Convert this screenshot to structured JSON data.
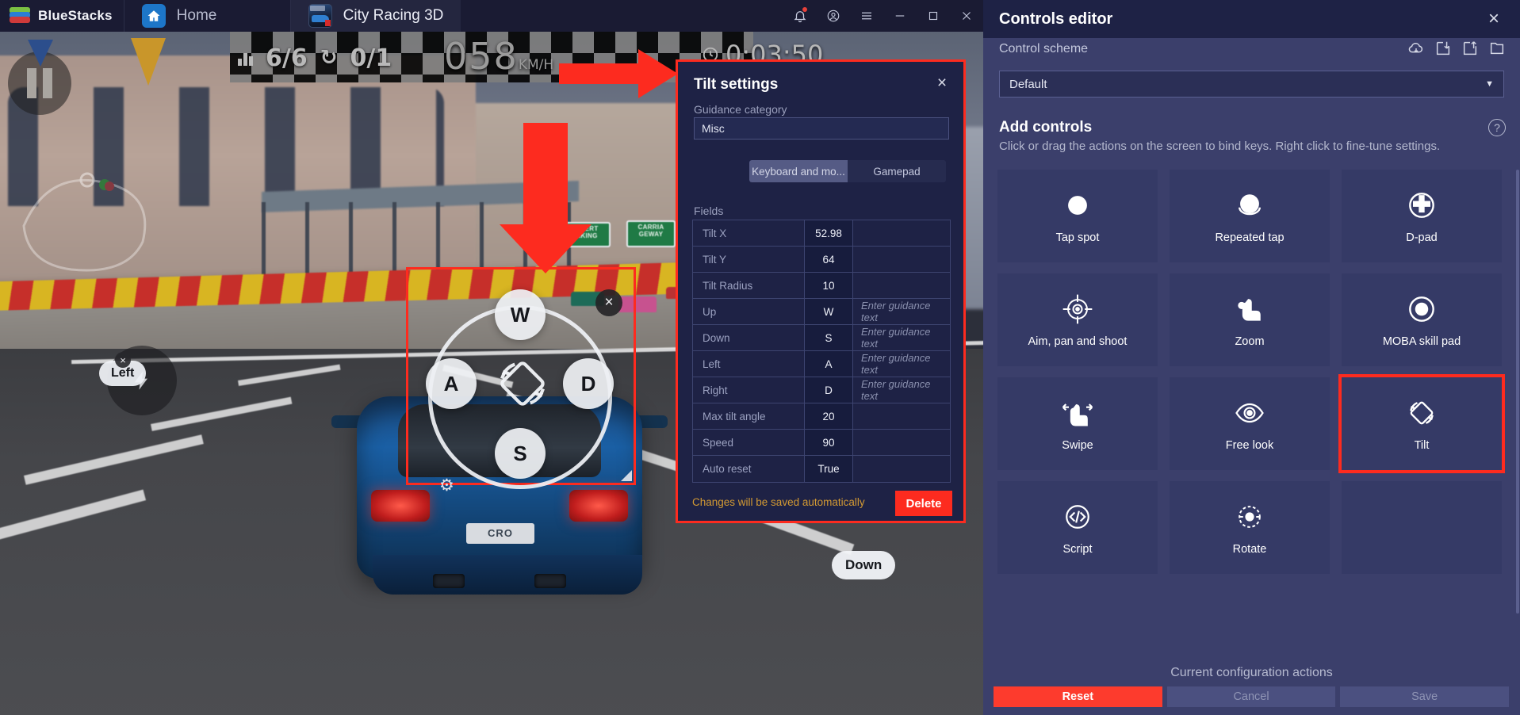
{
  "titlebar": {
    "brand": "BlueStacks",
    "tabs": [
      {
        "label": "Home",
        "icon": "home-icon"
      },
      {
        "label": "City Racing 3D",
        "icon": "game-thumbnail"
      }
    ],
    "window_buttons": [
      "notifications-bell",
      "account-circle",
      "hamburger-menu",
      "minimize",
      "maximize",
      "close"
    ]
  },
  "game_hud": {
    "position": "6/6",
    "laps": "0/1",
    "speed": "058",
    "speed_unit": "KM/H",
    "time": "0:03:50",
    "pause": "pause-icon"
  },
  "game_overlay": {
    "up_key": "W",
    "left_key": "A",
    "right_key": "D",
    "down_key": "S",
    "left_chip": "Left",
    "down_chip": "Down",
    "close": "×",
    "gear": "⚙",
    "car_plate": "CRO"
  },
  "tilt_dialog": {
    "title": "Tilt settings",
    "close": "×",
    "guidance_category_label": "Guidance category",
    "guidance_category_value": "Misc",
    "guidance_category_placeholder": "Guidance category",
    "segments": [
      {
        "label": "Keyboard and mo...",
        "active": true
      },
      {
        "label": "Gamepad",
        "active": false
      }
    ],
    "fields_label": "Fields",
    "guidance_placeholder": "Enter guidance text",
    "rows": [
      {
        "name": "Tilt X",
        "value": "52.98",
        "guidance": ""
      },
      {
        "name": "Tilt Y",
        "value": "64",
        "guidance": ""
      },
      {
        "name": "Tilt Radius",
        "value": "10",
        "guidance": ""
      },
      {
        "name": "Up",
        "value": "W",
        "guidance": "Enter guidance text"
      },
      {
        "name": "Down",
        "value": "S",
        "guidance": "Enter guidance text"
      },
      {
        "name": "Left",
        "value": "A",
        "guidance": "Enter guidance text"
      },
      {
        "name": "Right",
        "value": "D",
        "guidance": "Enter guidance text"
      },
      {
        "name": "Max tilt angle",
        "value": "20",
        "guidance": ""
      },
      {
        "name": "Speed",
        "value": "90",
        "guidance": ""
      },
      {
        "name": "Auto reset",
        "value": "True",
        "guidance": ""
      }
    ],
    "autosave_note": "Changes will be saved automatically",
    "delete_label": "Delete"
  },
  "editor": {
    "title": "Controls editor",
    "close": "×",
    "scheme_label": "Control scheme",
    "scheme_icons": [
      "cloud-download-icon",
      "import-icon",
      "export-icon",
      "folder-icon"
    ],
    "scheme_value": "Default",
    "scheme_caret": "▼",
    "add_controls_title": "Add controls",
    "help_icon": "?",
    "add_controls_desc": "Click or drag the actions on the screen to bind keys. Right click to fine-tune settings.",
    "tiles": [
      {
        "label": "Tap spot",
        "icon": "tap-spot-icon",
        "selected": false
      },
      {
        "label": "Repeated tap",
        "icon": "repeated-tap-icon",
        "selected": false
      },
      {
        "label": "D-pad",
        "icon": "dpad-icon",
        "selected": false
      },
      {
        "label": "Aim, pan and shoot",
        "icon": "crosshair-icon",
        "selected": false
      },
      {
        "label": "Zoom",
        "icon": "zoom-pinch-icon",
        "selected": false
      },
      {
        "label": "MOBA skill pad",
        "icon": "moba-skill-icon",
        "selected": false
      },
      {
        "label": "Swipe",
        "icon": "swipe-icon",
        "selected": false
      },
      {
        "label": "Free look",
        "icon": "free-look-icon",
        "selected": false
      },
      {
        "label": "Tilt",
        "icon": "tilt-icon",
        "selected": true
      },
      {
        "label": "Script",
        "icon": "script-icon",
        "selected": false
      },
      {
        "label": "Rotate",
        "icon": "rotate-icon",
        "selected": false
      }
    ],
    "config_title": "Current configuration actions",
    "buttons": [
      {
        "label": "Reset",
        "style": "primary"
      },
      {
        "label": "Cancel",
        "style": "disabled"
      },
      {
        "label": "Save",
        "style": "disabled"
      }
    ]
  },
  "colors": {
    "accent_red": "#fd2b1f",
    "panel_bg": "#3b3f6b",
    "tile_bg": "#353a66",
    "dialog_bg": "#1e2245",
    "warning_orange": "#d39a33"
  }
}
